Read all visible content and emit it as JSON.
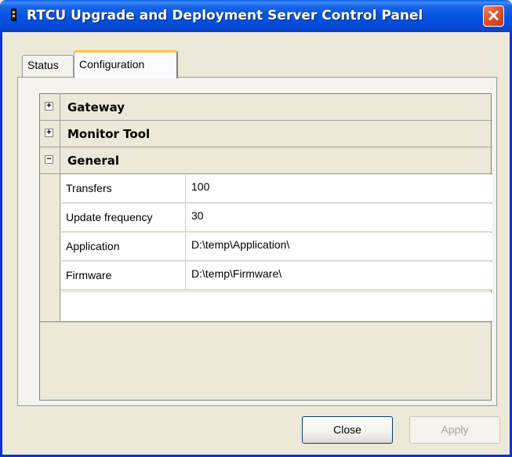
{
  "window": {
    "title": "RTCU Upgrade and Deployment Server Control Panel",
    "close_symbol": "✕"
  },
  "tabs": [
    {
      "label": "Status"
    },
    {
      "label": "Configuration"
    }
  ],
  "property_grid": {
    "categories": [
      {
        "label": "Gateway",
        "expander": "+"
      },
      {
        "label": "Monitor Tool",
        "expander": "+"
      },
      {
        "label": "General",
        "expander": "−"
      }
    ],
    "rows": [
      {
        "name": "Transfers",
        "value": "100"
      },
      {
        "name": "Update frequency",
        "value": "30"
      },
      {
        "name": "Application",
        "value": "D:\\temp\\Application\\"
      },
      {
        "name": "Firmware",
        "value": "D:\\temp\\Firmware\\"
      }
    ]
  },
  "buttons": {
    "close_label": "Close",
    "apply_label": "Apply"
  },
  "colors": {
    "titlebar": "#0554e3",
    "close_button": "#e2522c",
    "tab_highlight": "#ffc83c"
  }
}
